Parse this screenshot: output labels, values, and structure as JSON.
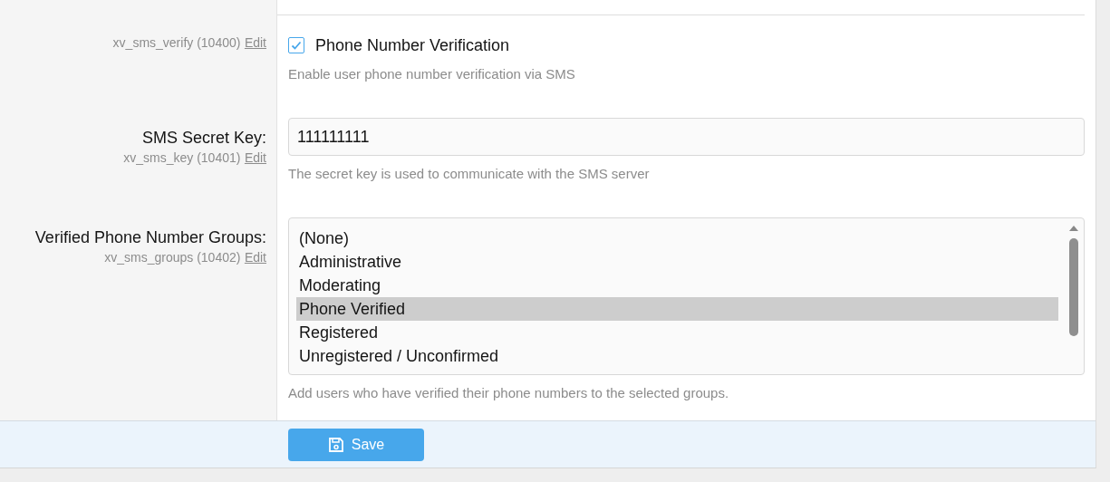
{
  "rows": [
    {
      "kind": "checkbox",
      "hint": "xv_sms_verify (10400)",
      "edit_link": "Edit",
      "label": "Phone Number Verification",
      "checked": true,
      "explain": "Enable user phone number verification via SMS"
    },
    {
      "kind": "text",
      "title": "SMS Secret Key:",
      "hint": "xv_sms_key (10401)",
      "edit_link": "Edit",
      "value": "111111111",
      "explain": "The secret key is used to communicate with the SMS server"
    },
    {
      "kind": "select",
      "title": "Verified Phone Number Groups:",
      "hint": "xv_sms_groups (10402)",
      "edit_link": "Edit",
      "options": [
        {
          "label": "(None)",
          "selected": false
        },
        {
          "label": "Administrative",
          "selected": false
        },
        {
          "label": "Moderating",
          "selected": false
        },
        {
          "label": "Phone Verified",
          "selected": true
        },
        {
          "label": "Registered",
          "selected": false
        },
        {
          "label": "Unregistered / Unconfirmed",
          "selected": false
        }
      ],
      "explain": "Add users who have verified their phone numbers to the selected groups."
    }
  ],
  "save_button": "Save"
}
